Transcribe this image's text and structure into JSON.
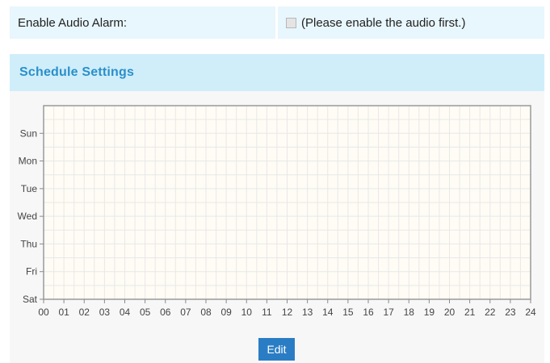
{
  "alarm": {
    "label": "Enable Audio Alarm:",
    "checked": false,
    "note": "(Please enable the audio first.)"
  },
  "schedule": {
    "title": "Schedule Settings",
    "edit_label": "Edit"
  },
  "chart_data": {
    "type": "heatmap",
    "title": "",
    "xlabel": "",
    "ylabel": "",
    "x_ticks": [
      "00",
      "01",
      "02",
      "03",
      "04",
      "05",
      "06",
      "07",
      "08",
      "09",
      "10",
      "11",
      "12",
      "13",
      "14",
      "15",
      "16",
      "17",
      "18",
      "19",
      "20",
      "21",
      "22",
      "23",
      "24"
    ],
    "y_ticks": [
      "Sun",
      "Mon",
      "Tue",
      "Wed",
      "Thu",
      "Fri",
      "Sat"
    ],
    "xlim": [
      0,
      24
    ],
    "grid": true,
    "scheduled_ranges": []
  }
}
